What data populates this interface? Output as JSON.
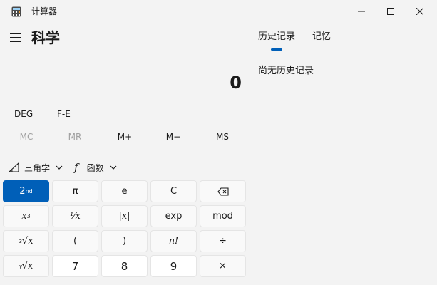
{
  "window": {
    "title": "计算器",
    "icons": {
      "app": "calculator-icon",
      "minimize": "minimize-icon",
      "maximize": "maximize-icon",
      "close": "close-icon"
    }
  },
  "header": {
    "menu_icon": "hamburger-menu-icon",
    "mode_title": "科学"
  },
  "display": {
    "value": "0"
  },
  "options": {
    "angle_mode": "DEG",
    "notation": "F-E"
  },
  "memory": {
    "buttons": [
      {
        "label": "MC",
        "enabled": false
      },
      {
        "label": "MR",
        "enabled": false
      },
      {
        "label": "M+",
        "enabled": true
      },
      {
        "label": "M−",
        "enabled": true
      },
      {
        "label": "MS",
        "enabled": true
      }
    ]
  },
  "functions": {
    "trig_label": "三角学",
    "func_label": "函数",
    "func_glyph": "f",
    "trig_icon": "triangle-ruler-icon",
    "dropdown_icon": "chevron-down-icon"
  },
  "keypad": {
    "second": "nd",
    "pi": "π",
    "e": "e",
    "clear": "C",
    "x_cube_base": "x",
    "x_cube_exp": "3",
    "reciprocal": "¹⁄x",
    "abs": "|x|",
    "exp": "exp",
    "mod": "mod",
    "cube_root_idx": "3",
    "cube_root_x": "x",
    "lparen": "(",
    "rparen": ")",
    "factorial": "n!",
    "divide": "÷",
    "y_root_idx": "y",
    "y_root_x": "x",
    "seven": "7",
    "eight": "8",
    "nine": "9",
    "multiply": "×",
    "backspace_icon": "backspace-icon"
  },
  "history_panel": {
    "tabs": [
      {
        "label": "历史记录",
        "active": true
      },
      {
        "label": "记忆",
        "active": false
      }
    ],
    "empty_message": "尚无历史记录"
  },
  "colors": {
    "accent": "#005fb8",
    "background": "#f3f3f3",
    "key": "#f9f9f9",
    "number_key": "#ffffff"
  }
}
